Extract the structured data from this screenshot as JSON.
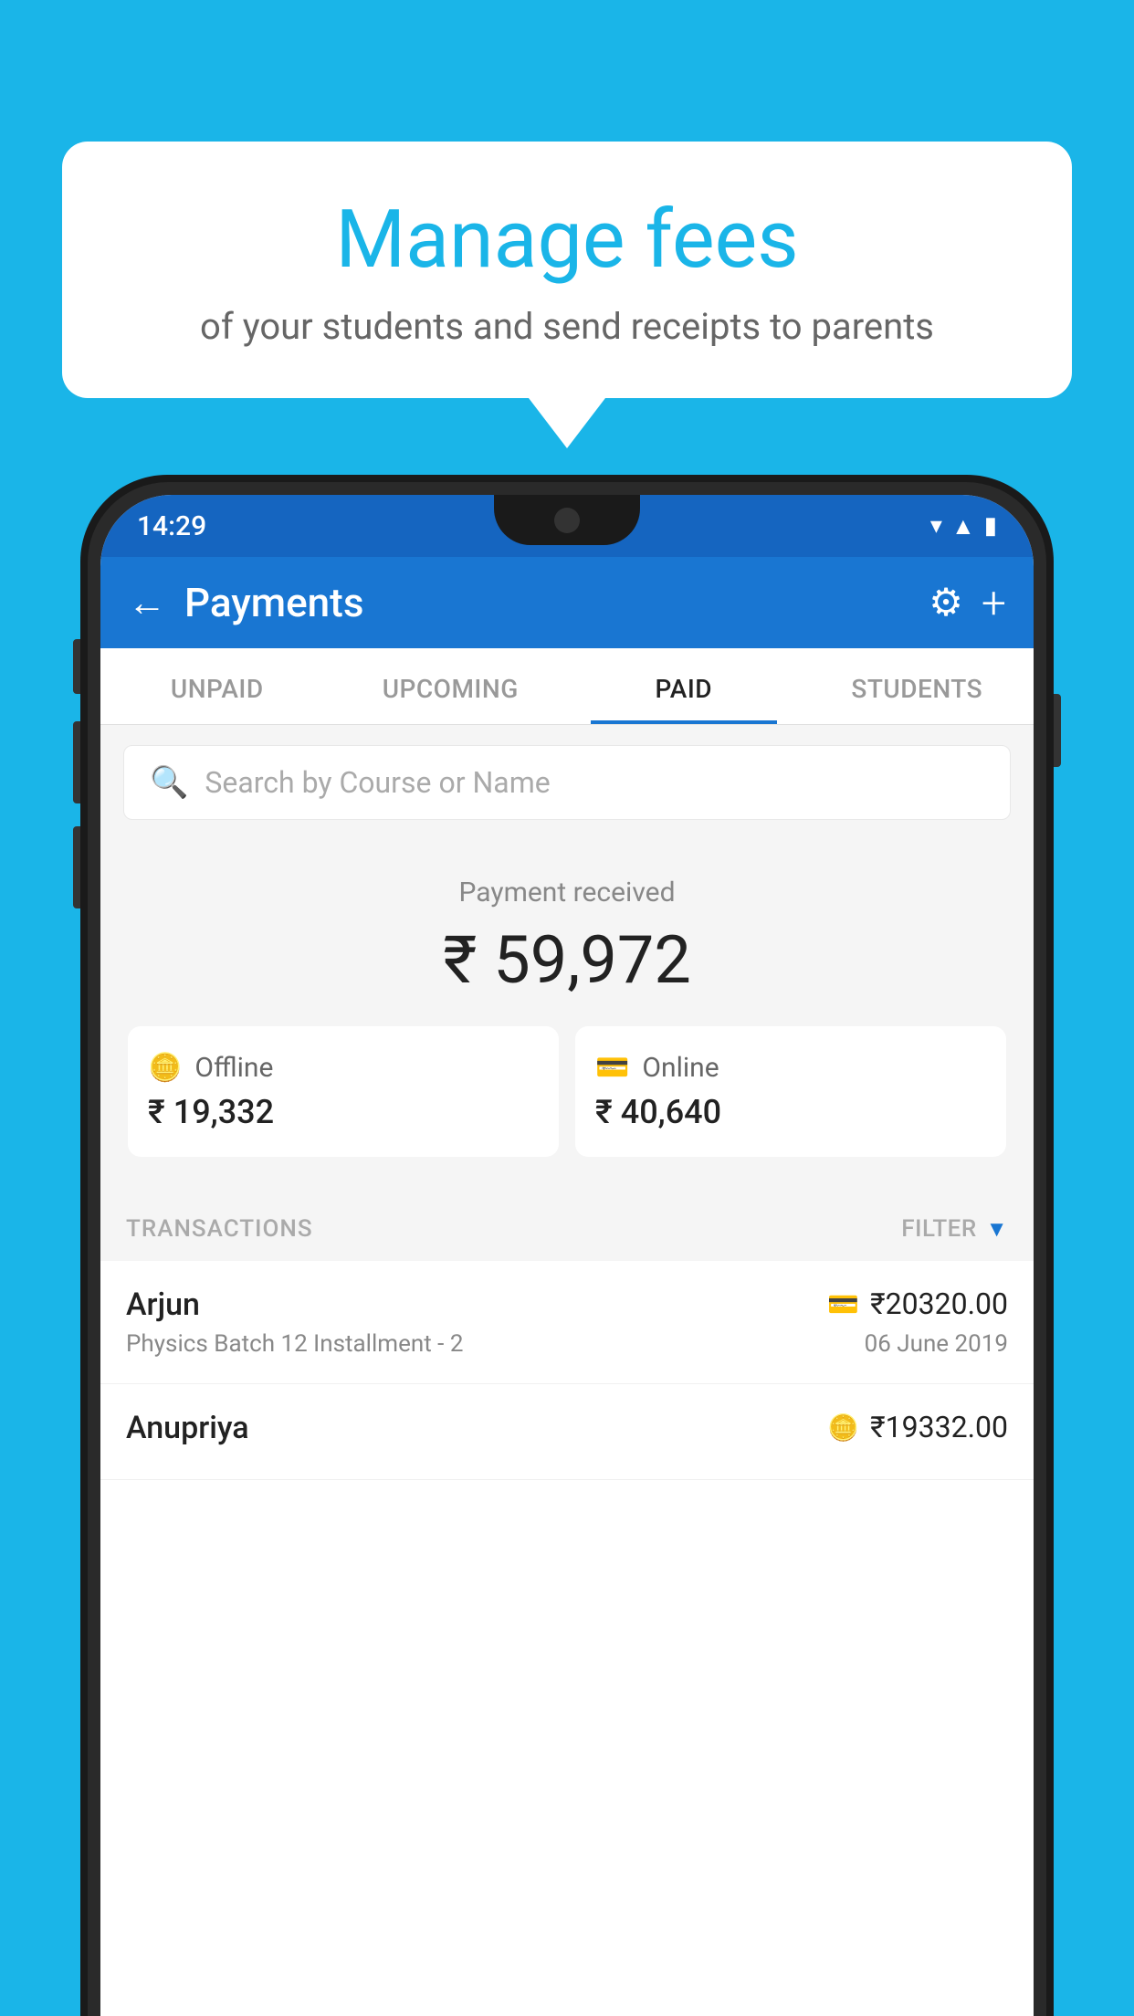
{
  "background_color": "#1ab5e8",
  "speech_bubble": {
    "title": "Manage fees",
    "subtitle": "of your students and send receipts to parents"
  },
  "status_bar": {
    "time": "14:29"
  },
  "header": {
    "title": "Payments",
    "back_label": "←",
    "gear_label": "⚙",
    "plus_label": "+"
  },
  "tabs": [
    {
      "label": "UNPAID",
      "active": false
    },
    {
      "label": "UPCOMING",
      "active": false
    },
    {
      "label": "PAID",
      "active": true
    },
    {
      "label": "STUDENTS",
      "active": false
    }
  ],
  "search": {
    "placeholder": "Search by Course or Name"
  },
  "payment_received": {
    "label": "Payment received",
    "total": "₹ 59,972",
    "offline_label": "Offline",
    "offline_amount": "₹ 19,332",
    "online_label": "Online",
    "online_amount": "₹ 40,640"
  },
  "transactions": {
    "section_label": "TRANSACTIONS",
    "filter_label": "FILTER",
    "rows": [
      {
        "name": "Arjun",
        "course": "Physics Batch 12 Installment - 2",
        "amount": "₹20320.00",
        "date": "06 June 2019",
        "payment_type": "online"
      },
      {
        "name": "Anupriya",
        "course": "",
        "amount": "₹19332.00",
        "date": "",
        "payment_type": "offline"
      }
    ]
  }
}
